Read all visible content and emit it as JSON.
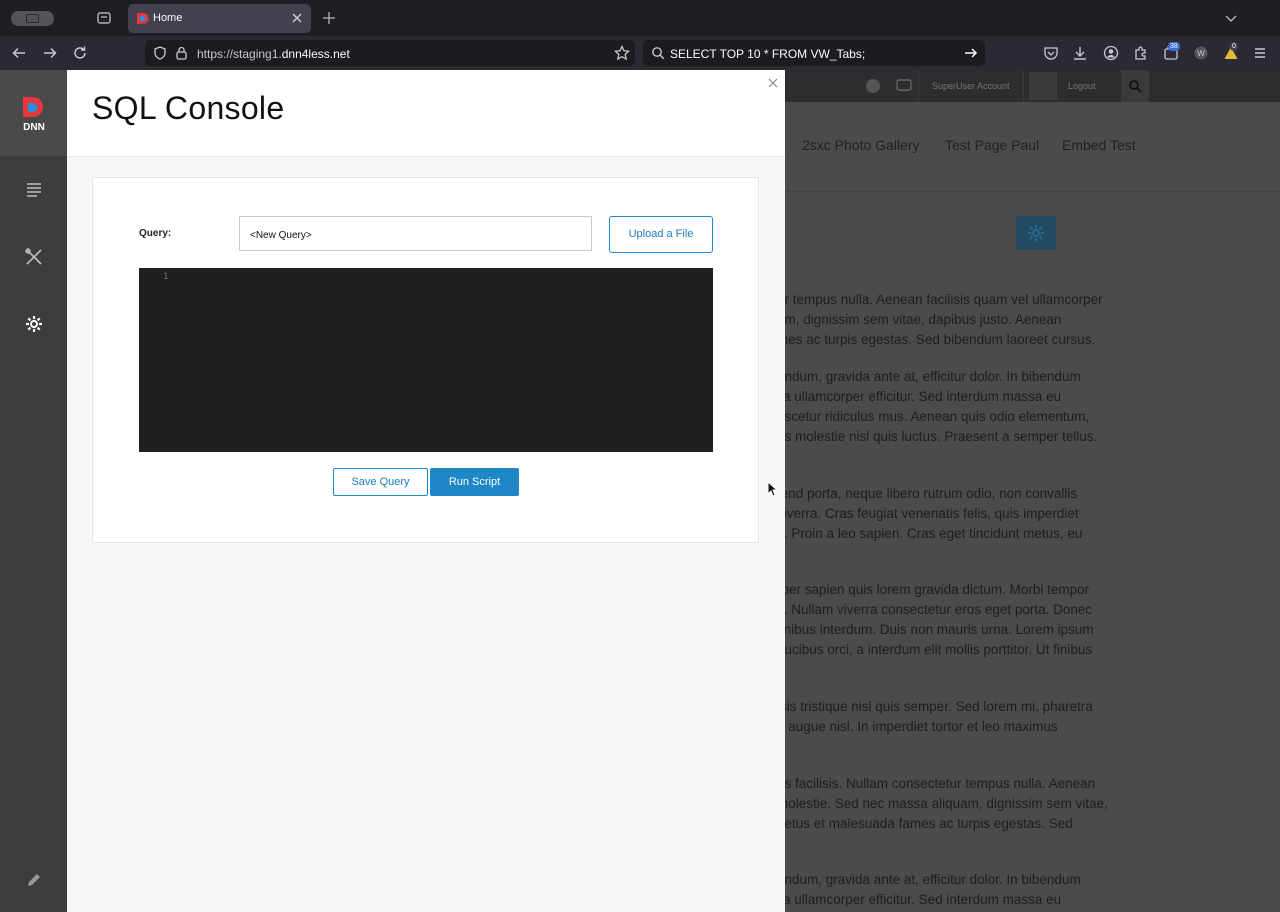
{
  "browser": {
    "tab_title": "Home",
    "url_prefix": "https://staging1.",
    "url_domain": "dnn4less.net",
    "search_text": "SELECT TOP 10 * FROM VW_Tabs;",
    "badge_count_1": "38",
    "badge_count_2": "0",
    "accent_color": "#1e88c7"
  },
  "persona_bar": {
    "logo_text": "DNN",
    "items": [
      "content-icon",
      "manage-icon",
      "settings-icon",
      "edit-icon"
    ]
  },
  "site": {
    "top_user": "SuperUser Account",
    "top_logout": "Logout",
    "nav": [
      "2sxc Photo Gallery",
      "Test Page Paul",
      "Embed Test"
    ],
    "body_lines": [
      "ur tempus nulla. Aenean facilisis quam vel ullamcorper",
      "am, dignissim sem vitae, dapibus justo. Aenean",
      "mes ac turpis egestas. Sed bibendum laoreet cursus.",
      "endum, gravida ante at, efficitur dolor. In bibendum",
      "lla ullamcorper efficitur. Sed interdum massa eu",
      "ascetur ridiculus mus. Aenean quis odio elementum,",
      "es molestie nisl quis luctus. Praesent a semper tellus.",
      "fend porta, neque libero rutrum odio, non convallis",
      " viverra. Cras feugiat venenatis felis, quis imperdiet",
      "s. Proin a leo sapien. Cras eget tincidunt metus, eu",
      "rper sapien quis lorem gravida dictum. Morbi tempor",
      "s. Nullam viverra consectetur eros eget porta. Donec",
      " finibus interdum. Duis non mauris urna. Lorem ipsum",
      "aucibus orci, a interdum elit mollis porttitor. Ut finibus",
      "isis tristique nisl quis semper. Sed lorem mi, pharetra",
      "d augue nisl. In imperdiet tortor et leo maximus",
      "us facilisis. Nullam consectetur tempus nulla. Aenean",
      " molestie. Sed nec massa aliquam, dignissim sem vitae,",
      "netus et malesuada fames ac turpis egestas. Sed",
      "endum, gravida ante at, efficitur dolor. In bibendum",
      "lla ullamcorper efficitur. Sed interdum massa eu"
    ]
  },
  "console": {
    "title": "SQL Console",
    "query_label": "Query:",
    "query_value": "<New Query>",
    "upload_label": "Upload a File",
    "line_number": "1",
    "save_label": "Save Query",
    "run_label": "Run Script"
  }
}
